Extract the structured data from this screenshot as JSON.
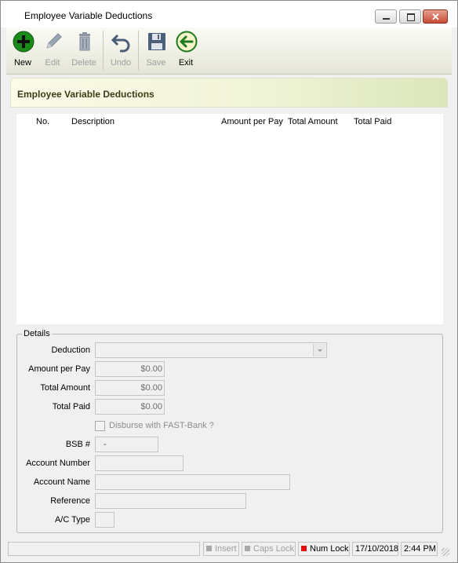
{
  "window": {
    "title": "Employee Variable Deductions"
  },
  "toolbar": {
    "new": "New",
    "edit": "Edit",
    "delete": "Delete",
    "undo": "Undo",
    "save": "Save",
    "exit": "Exit"
  },
  "panel": {
    "title": "Employee Variable Deductions"
  },
  "list": {
    "columns": [
      "No.",
      "Description",
      "Amount per Pay",
      "Total Amount",
      "Total Paid"
    ]
  },
  "details": {
    "legend": "Details",
    "deduction_label": "Deduction",
    "deduction_value": "",
    "amount_per_pay_label": "Amount per Pay",
    "amount_per_pay_value": "$0.00",
    "total_amount_label": "Total Amount",
    "total_amount_value": "$0.00",
    "total_paid_label": "Total Paid",
    "total_paid_value": "$0.00",
    "disburse_label": "Disburse with FAST-Bank ?",
    "bsb_label": "BSB #",
    "bsb_value": "-",
    "account_number_label": "Account Number",
    "account_name_label": "Account Name",
    "reference_label": "Reference",
    "ac_type_label": "A/C Type"
  },
  "statusbar": {
    "insert": "Insert",
    "caps_lock": "Caps Lock",
    "num_lock": "Num Lock",
    "date": "17/10/2018",
    "time": "2:44 PM"
  },
  "colors": {
    "new_icon": "#1a8a1a",
    "exit_icon_ring": "#1d7a1d",
    "num_lock_indicator": "#e01010",
    "inactive_indicator": "#a8a8a8"
  }
}
